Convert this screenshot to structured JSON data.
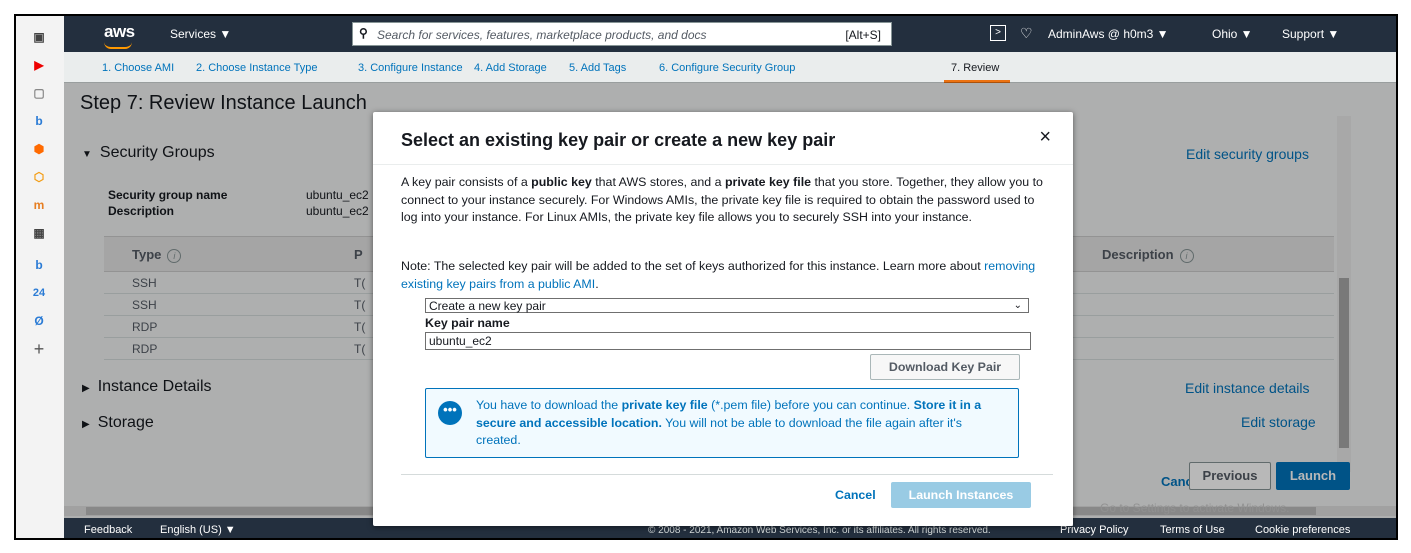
{
  "rail_icons": [
    "tab-icon",
    "youtube-icon",
    "page-icon",
    "b-icon",
    "box-icon",
    "cube-icon",
    "m-icon",
    "calc-icon",
    "b2-icon",
    "24-icon",
    "d-icon",
    "plus-icon"
  ],
  "rail_glyphs": [
    "▣",
    "▶",
    "▢",
    "b",
    "⬢",
    "⬡",
    "m",
    "▦",
    "b",
    "24",
    "Ø",
    "+"
  ],
  "topnav": {
    "logo": "aws",
    "services": "Services ▼",
    "search_placeholder": "Search for services, features, marketplace products, and docs",
    "search_shortcut": "[Alt+S]",
    "account": "AdminAws @ h0m3 ▼",
    "region": "Ohio ▼",
    "support": "Support ▼"
  },
  "wizard_steps": [
    "1. Choose AMI",
    "2. Choose Instance Type",
    "3. Configure Instance",
    "4. Add Storage",
    "5. Add Tags",
    "6. Configure Security Group",
    "7. Review"
  ],
  "page_title": "Step 7: Review Instance Launch",
  "security_groups": {
    "title": "Security Groups",
    "edit": "Edit security groups",
    "name_label": "Security group name",
    "name_value": "ubuntu_ec2",
    "desc_label": "Description",
    "desc_value": "ubuntu_ec2",
    "col_type": "Type",
    "col_protocol": "P",
    "col_description": "Description",
    "rows": [
      {
        "type": "SSH",
        "protocol": "T("
      },
      {
        "type": "SSH",
        "protocol": "T("
      },
      {
        "type": "RDP",
        "protocol": "T("
      },
      {
        "type": "RDP",
        "protocol": "T("
      }
    ]
  },
  "instance_details": {
    "title": "Instance Details",
    "edit": "Edit instance details"
  },
  "storage": {
    "title": "Storage",
    "edit": "Edit storage"
  },
  "bottom_buttons": {
    "cancel": "Cancel",
    "previous": "Previous",
    "launch": "Launch"
  },
  "watermark": "Go to Settings to activate Windows.",
  "footer": {
    "feedback": "Feedback",
    "language": "English (US) ▼",
    "copyright": "© 2008 - 2021, Amazon Web Services, Inc. or its affiliates. All rights reserved.",
    "privacy": "Privacy Policy",
    "terms": "Terms of Use",
    "cookies": "Cookie preferences"
  },
  "modal": {
    "title": "Select an existing key pair or create a new key pair",
    "close": "×",
    "p1_a": "A key pair consists of a ",
    "p1_b": "public key",
    "p1_c": " that AWS stores, and a ",
    "p1_d": "private key file",
    "p1_e": " that you store. Together, they allow you to connect to your instance securely. For Windows AMIs, the private key file is required to obtain the password used to log into your instance. For Linux AMIs, the private key file allows you to securely SSH into your instance.",
    "p2_a": "Note: The selected key pair will be added to the set of keys authorized for this instance. Learn more about ",
    "p2_link": "removing existing key pairs from a public AMI",
    "p2_b": ".",
    "select_value": "Create a new key pair",
    "key_name_label": "Key pair name",
    "key_name_value": "ubuntu_ec2",
    "download": "Download Key Pair",
    "alert_a": "You have to download the ",
    "alert_b": "private key file",
    "alert_c": " (*.pem file) before you can continue. ",
    "alert_d": "Store it in a secure and accessible location.",
    "alert_e": " You will not be able to download the file again after it's created.",
    "cancel": "Cancel",
    "launch": "Launch Instances"
  }
}
